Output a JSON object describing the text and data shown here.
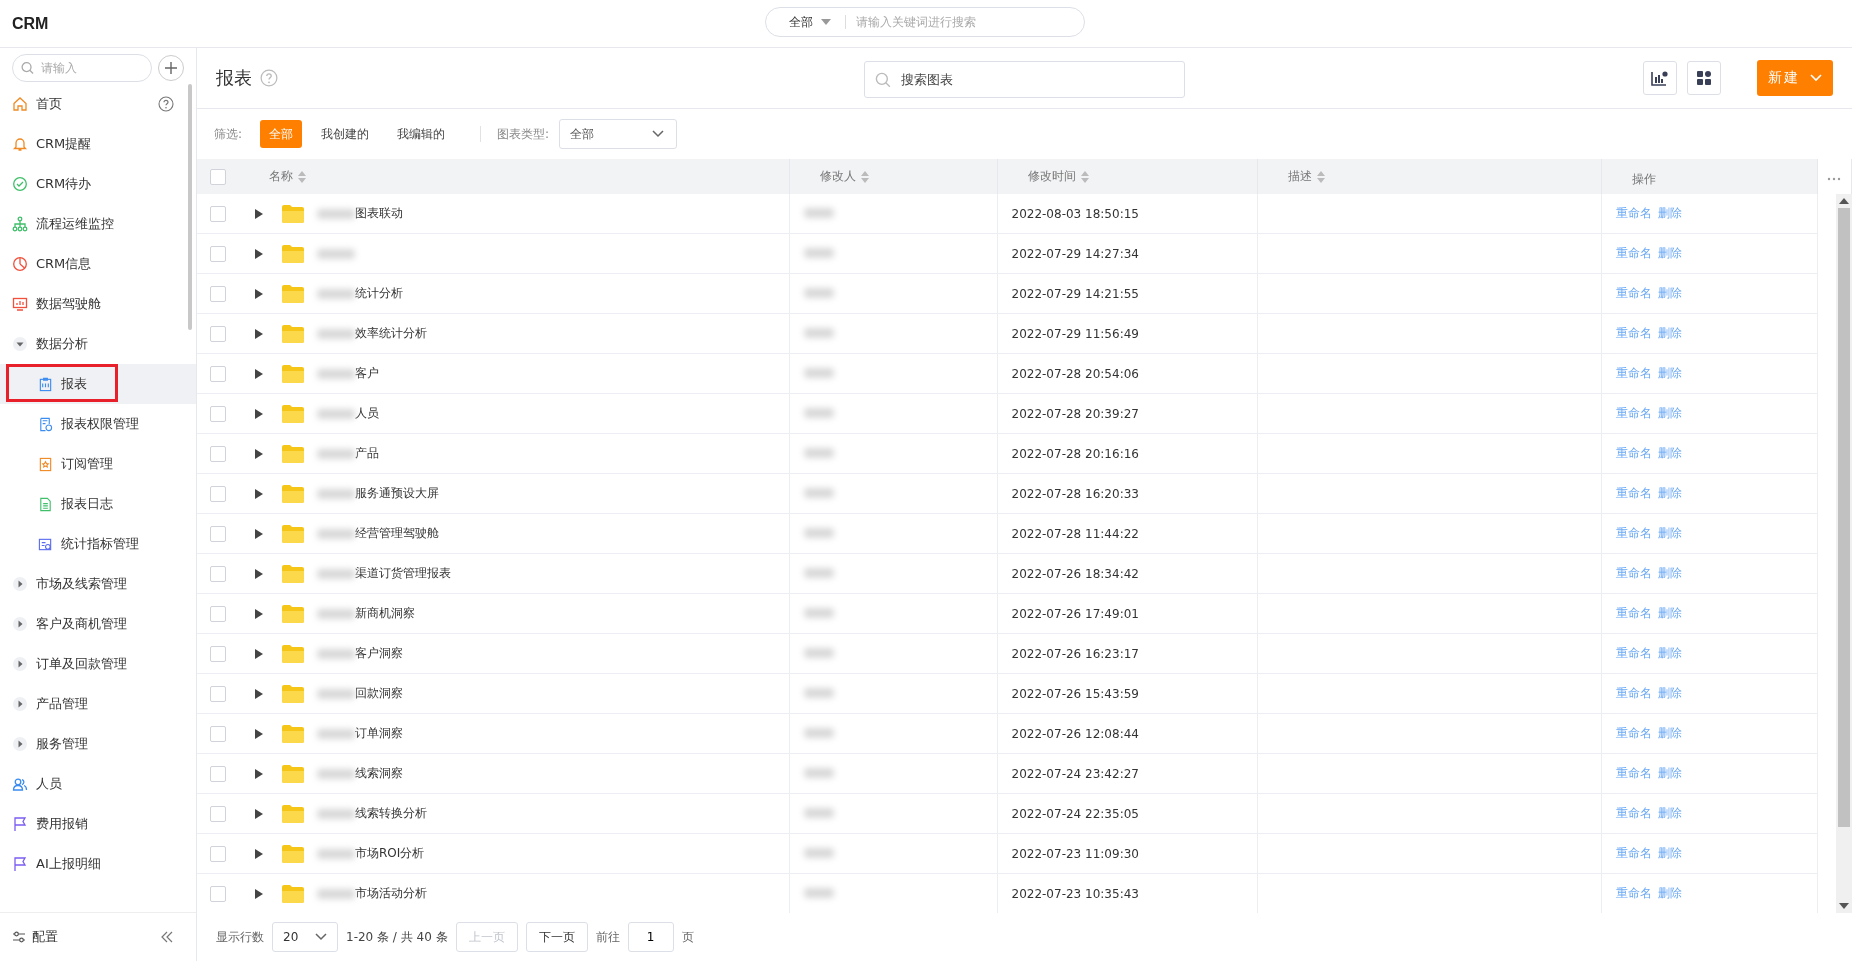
{
  "app": {
    "title": "CRM"
  },
  "global_search": {
    "scope": "全部",
    "placeholder": "请输入关键词进行搜索"
  },
  "sidebar": {
    "search_placeholder": "请输入",
    "items": [
      {
        "kind": "link",
        "label": "首页",
        "selected": false,
        "help": true
      },
      {
        "kind": "link",
        "label": "CRM提醒",
        "selected": false
      },
      {
        "kind": "link",
        "label": "CRM待办",
        "selected": false
      },
      {
        "kind": "link",
        "label": "流程运维监控",
        "selected": false
      },
      {
        "kind": "link",
        "label": "CRM信息",
        "selected": false
      },
      {
        "kind": "link",
        "label": "数据驾驶舱",
        "selected": false
      },
      {
        "kind": "group",
        "label": "数据分析",
        "expanded": true,
        "children": [
          {
            "label": "报表",
            "selected": true
          },
          {
            "label": "报表权限管理",
            "selected": false
          },
          {
            "label": "订阅管理",
            "selected": false
          },
          {
            "label": "报表日志",
            "selected": false
          },
          {
            "label": "统计指标管理",
            "selected": false
          }
        ]
      },
      {
        "kind": "group",
        "label": "市场及线索管理",
        "expanded": false
      },
      {
        "kind": "group",
        "label": "客户及商机管理",
        "expanded": false
      },
      {
        "kind": "group",
        "label": "订单及回款管理",
        "expanded": false
      },
      {
        "kind": "group",
        "label": "产品管理",
        "expanded": false
      },
      {
        "kind": "group",
        "label": "服务管理",
        "expanded": false
      },
      {
        "kind": "link",
        "label": "人员",
        "selected": false
      },
      {
        "kind": "link",
        "label": "费用报销",
        "selected": false
      },
      {
        "kind": "link",
        "label": "AI上报明细",
        "selected": false
      }
    ],
    "footer": "配置"
  },
  "page": {
    "title": "报表",
    "search_placeholder": "搜索图表",
    "new_button": "新建"
  },
  "filter": {
    "label": "筛选:",
    "options": [
      {
        "label": "全部",
        "selected": true
      },
      {
        "label": "我创建的",
        "selected": false
      },
      {
        "label": "我编辑的",
        "selected": false
      }
    ],
    "type_label": "图表类型:",
    "type_value": "全部"
  },
  "table": {
    "all_checked": false,
    "columns": [
      "名称",
      "修改人",
      "修改时间",
      "描述",
      "操作"
    ],
    "rows": [
      {
        "checked": false,
        "name": "图表联动",
        "modified": "2022-08-03 18:50:15",
        "actions": [
          "重命名",
          "删除"
        ]
      },
      {
        "checked": false,
        "modified": "2022-07-29 14:27:34",
        "actions": [
          "重命名",
          "删除"
        ]
      },
      {
        "checked": false,
        "name": "统计分析",
        "modified": "2022-07-29 14:21:55",
        "actions": [
          "重命名",
          "删除"
        ]
      },
      {
        "checked": false,
        "name": "效率统计分析",
        "modified": "2022-07-29 11:56:49",
        "actions": [
          "重命名",
          "删除"
        ]
      },
      {
        "checked": false,
        "name": "客户",
        "modified": "2022-07-28 20:54:06",
        "actions": [
          "重命名",
          "删除"
        ]
      },
      {
        "checked": false,
        "name": "人员",
        "modified": "2022-07-28 20:39:27",
        "actions": [
          "重命名",
          "删除"
        ]
      },
      {
        "checked": false,
        "name": "产品",
        "modified": "2022-07-28 20:16:16",
        "actions": [
          "重命名",
          "删除"
        ]
      },
      {
        "checked": false,
        "name": "服务通预设大屏",
        "modified": "2022-07-28 16:20:33",
        "actions": [
          "重命名",
          "删除"
        ]
      },
      {
        "checked": false,
        "name": "经营管理驾驶舱",
        "modified": "2022-07-28 11:44:22",
        "actions": [
          "重命名",
          "删除"
        ]
      },
      {
        "checked": false,
        "name": "渠道订货管理报表",
        "modified": "2022-07-26 18:34:42",
        "actions": [
          "重命名",
          "删除"
        ]
      },
      {
        "checked": false,
        "name": "新商机洞察",
        "modified": "2022-07-26 17:49:01",
        "actions": [
          "重命名",
          "删除"
        ]
      },
      {
        "checked": false,
        "name": "客户洞察",
        "modified": "2022-07-26 16:23:17",
        "actions": [
          "重命名",
          "删除"
        ]
      },
      {
        "checked": false,
        "name": "回款洞察",
        "modified": "2022-07-26 15:43:59",
        "actions": [
          "重命名",
          "删除"
        ]
      },
      {
        "checked": false,
        "name": "订单洞察",
        "modified": "2022-07-26 12:08:44",
        "actions": [
          "重命名",
          "删除"
        ]
      },
      {
        "checked": false,
        "name": "线索洞察",
        "modified": "2022-07-24 23:42:27",
        "actions": [
          "重命名",
          "删除"
        ]
      },
      {
        "checked": false,
        "name": "线索转换分析",
        "modified": "2022-07-24 22:35:05",
        "actions": [
          "重命名",
          "删除"
        ]
      },
      {
        "checked": false,
        "name": "市场ROI分析",
        "modified": "2022-07-23 11:09:30",
        "actions": [
          "重命名",
          "删除"
        ]
      },
      {
        "checked": false,
        "name": "市场活动分析",
        "modified": "2022-07-23 10:35:43",
        "actions": [
          "重命名",
          "删除"
        ]
      }
    ]
  },
  "pagination": {
    "rows_label": "显示行数",
    "page_size": "20",
    "range": "1-20 条 / 共 40 条",
    "prev": "上一页",
    "prev_disabled": true,
    "next": "下一页",
    "next_disabled": false,
    "goto_label": "前往",
    "page": "1",
    "page_suffix": "页"
  }
}
